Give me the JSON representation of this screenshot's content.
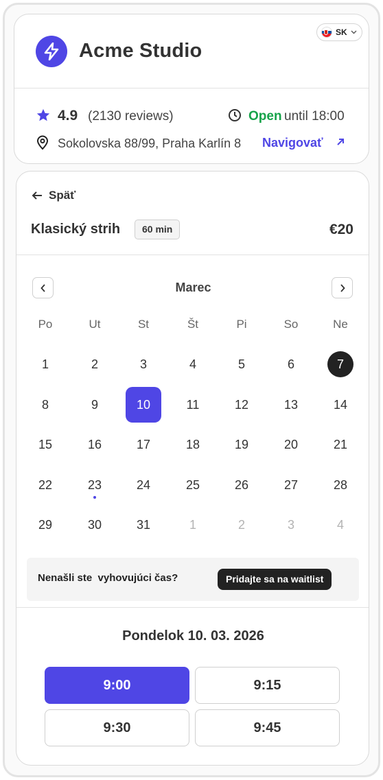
{
  "header": {
    "studio_name": "Acme Studio",
    "logo_icon": "lightning-bolt-icon",
    "language": {
      "code": "SK",
      "flag_icon": "slovakia-flag-icon"
    },
    "rating": "4.9",
    "reviews": "(2130 reviews)",
    "status_open": "Open",
    "status_hours": "until 18:00",
    "address": "Sokolovska 88/99, Praha Karlín 8",
    "navigate_label": "Navigovať",
    "accent_color": "#4f46e5",
    "open_color": "#16a34a"
  },
  "booking": {
    "back_label": "Späť",
    "service_name": "Klasický strih",
    "duration": "60 min",
    "price": "€20"
  },
  "calendar": {
    "month": "Marec",
    "weekdays": [
      "Po",
      "Ut",
      "St",
      "Št",
      "Pi",
      "So",
      "Ne"
    ],
    "weeks": [
      [
        "1",
        "2",
        "3",
        "4",
        "5",
        "6",
        "7"
      ],
      [
        "8",
        "9",
        "10",
        "11",
        "12",
        "13",
        "14"
      ],
      [
        "15",
        "16",
        "17",
        "18",
        "19",
        "20",
        "21"
      ],
      [
        "22",
        "23",
        "24",
        "25",
        "26",
        "27",
        "28"
      ],
      [
        "29",
        "30",
        "31",
        "1",
        "2",
        "3",
        "4"
      ]
    ],
    "selected_day": "10",
    "today_day": "7",
    "dot_day": "23"
  },
  "waitlist": {
    "text": "Nenašli ste  vyhovujúci čas?",
    "button_label": "Pridajte sa na waitlist"
  },
  "slots": {
    "date_heading": "Pondelok 10. 03. 2026",
    "times": [
      "9:00",
      "9:15",
      "9:30",
      "9:45"
    ],
    "selected": "9:00"
  }
}
